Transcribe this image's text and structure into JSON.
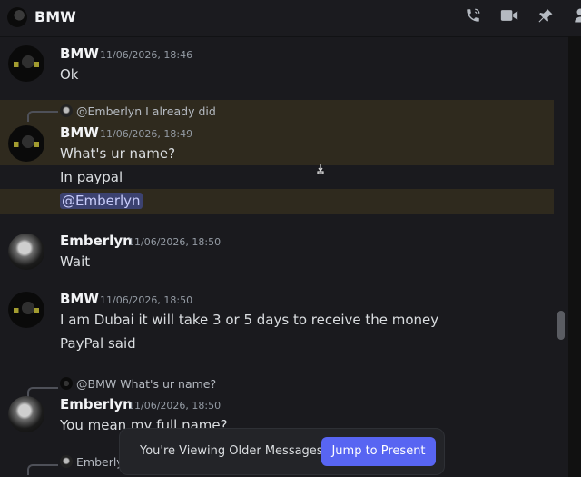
{
  "header": {
    "title": "BMW",
    "icons": [
      "phone-icon",
      "video-icon",
      "pin-icon",
      "members-icon"
    ]
  },
  "messages": [
    {
      "author": "BMW",
      "timestamp": "11/06/2026, 18:46",
      "lines": [
        "Ok"
      ]
    },
    {
      "reply": {
        "mention": "@Emberlyn",
        "text": "I already did"
      },
      "author": "BMW",
      "timestamp": "11/06/2026, 18:49",
      "lines": [
        "What's ur name?",
        "In paypal"
      ],
      "mention_line": "@Emberlyn"
    },
    {
      "author": "Emberlyn",
      "timestamp": "11/06/2026, 18:50",
      "lines": [
        "Wait"
      ]
    },
    {
      "author": "BMW",
      "timestamp": "11/06/2026, 18:50",
      "lines": [
        "I am Dubai it will take 3 or 5 days to receive the money",
        "PayPal said"
      ]
    },
    {
      "reply": {
        "mention": "@BMW",
        "text": "What's ur name?"
      },
      "author": "Emberlyn",
      "timestamp": "11/06/2026, 18:50",
      "lines": [
        "You mean my full name?"
      ]
    },
    {
      "reply": {
        "mention": "Emberly",
        "text": ""
      }
    }
  ],
  "banner": {
    "label": "You're Viewing Older Messages",
    "button": "Jump to Present"
  },
  "colors": {
    "accent": "#5865f2",
    "highlight": "#2f2a1e",
    "mention_bg": "#3c4270"
  }
}
